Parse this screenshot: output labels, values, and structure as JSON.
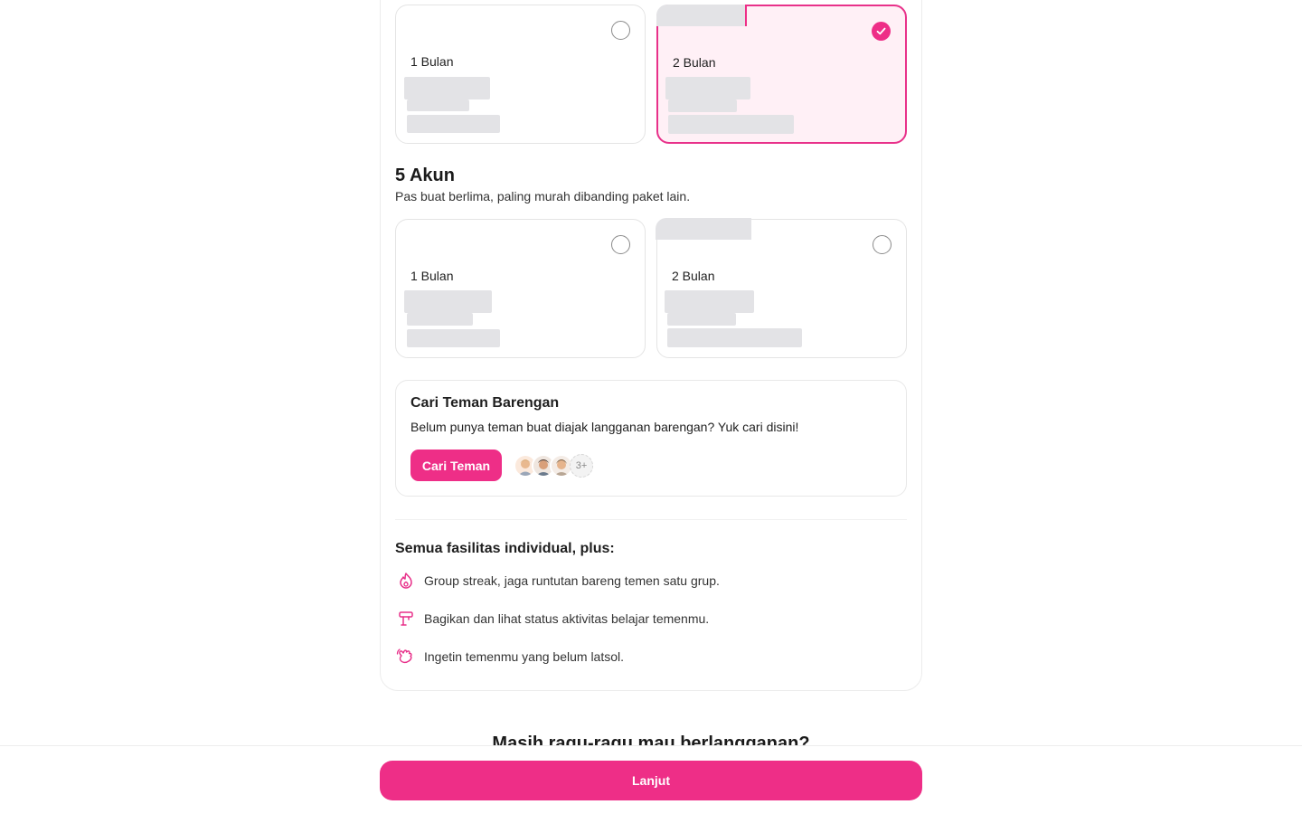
{
  "group_two": {
    "plans": [
      {
        "label": "1 Bulan",
        "selected": false
      },
      {
        "label": "2 Bulan",
        "selected": true
      }
    ]
  },
  "group_five": {
    "title": "5 Akun",
    "subtitle": "Pas buat berlima, paling murah dibanding paket lain.",
    "plans": [
      {
        "label": "1 Bulan",
        "selected": false
      },
      {
        "label": "2 Bulan",
        "selected": false
      }
    ]
  },
  "find_friends": {
    "title": "Cari Teman Barengan",
    "description": "Belum punya teman buat diajak langganan barengan? Yuk cari disini!",
    "button_label": "Cari Teman",
    "more_count": "3+"
  },
  "features": {
    "title": "Semua fasilitas individual, plus:",
    "items": [
      {
        "icon": "flame-icon",
        "text": "Group streak, jaga runtutan bareng temen satu grup."
      },
      {
        "icon": "lamp-icon",
        "text": "Bagikan dan lihat status aktivitas belajar temenmu."
      },
      {
        "icon": "wave-hand-icon",
        "text": "Ingetin temenmu yang belum latsol."
      }
    ]
  },
  "teaser_text": "Masih ragu-ragu mau berlangganan?",
  "cta_label": "Lanjut",
  "colors": {
    "accent": "#ee2e87",
    "selected_bg": "#fff0f6",
    "skeleton": "#e3e3e6"
  }
}
